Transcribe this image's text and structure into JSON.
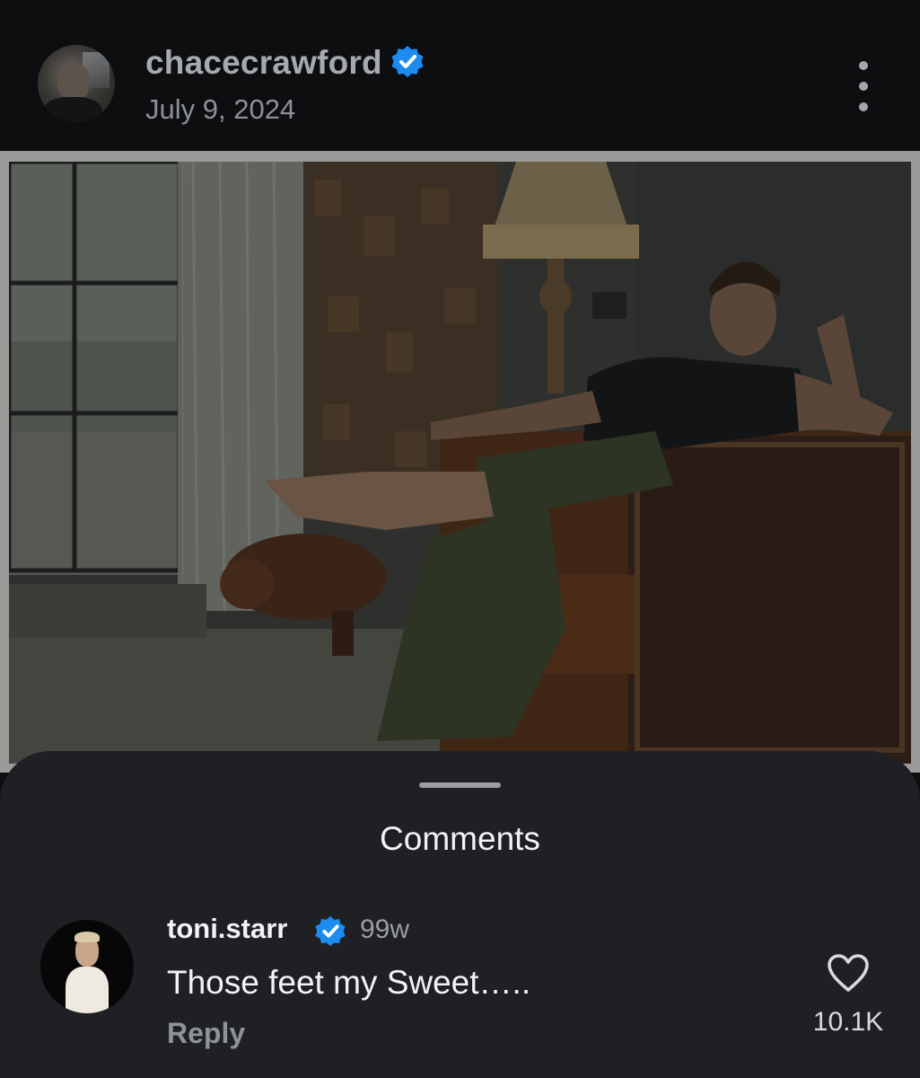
{
  "post": {
    "username": "chacecrawford",
    "date": "July 9, 2024",
    "verified": true
  },
  "comments_sheet": {
    "title": "Comments",
    "comments": [
      {
        "username": "toni.starr",
        "verified": true,
        "age": "99w",
        "text": "Those feet my Sweet…..",
        "reply_label": "Reply",
        "like_count": "10.1K"
      }
    ]
  },
  "icons": {
    "verified": "verified-badge-icon",
    "more": "more-vertical-icon",
    "like": "heart-outline-icon"
  },
  "colors": {
    "verified_blue": "#1d8cf0",
    "sheet_background": "#1f2024",
    "header_background": "#0d0e10"
  }
}
